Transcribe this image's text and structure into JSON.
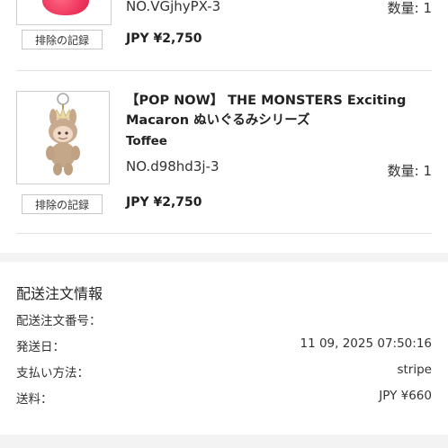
{
  "items": [
    {
      "sku": "NO.VGjhyPX-3",
      "quantity": "数量: 1",
      "remove_label": "排除の記録",
      "price": "JPY ¥2,750",
      "image_icon": "pink-plush-icon"
    },
    {
      "title": "【POP NOW】 THE MONSTERS Exciting Macaron ぬいぐるみシリーズ",
      "variant": "Toffee",
      "sku": "NO.d98hd3j-3",
      "quantity": "数量: 1",
      "remove_label": "排除の記録",
      "price": "JPY ¥2,750",
      "image_icon": "labubu-keychain-icon"
    }
  ],
  "shipping_info": {
    "title": "配送注文情報",
    "rows": [
      {
        "label": "配送注文番号：",
        "value": ""
      },
      {
        "label": "発送日：",
        "value": "11 09, 2025 07:50:16"
      },
      {
        "label": "支払い方法：",
        "value": "stripe"
      },
      {
        "label": "送料：",
        "value": "JPY ¥660"
      }
    ]
  }
}
